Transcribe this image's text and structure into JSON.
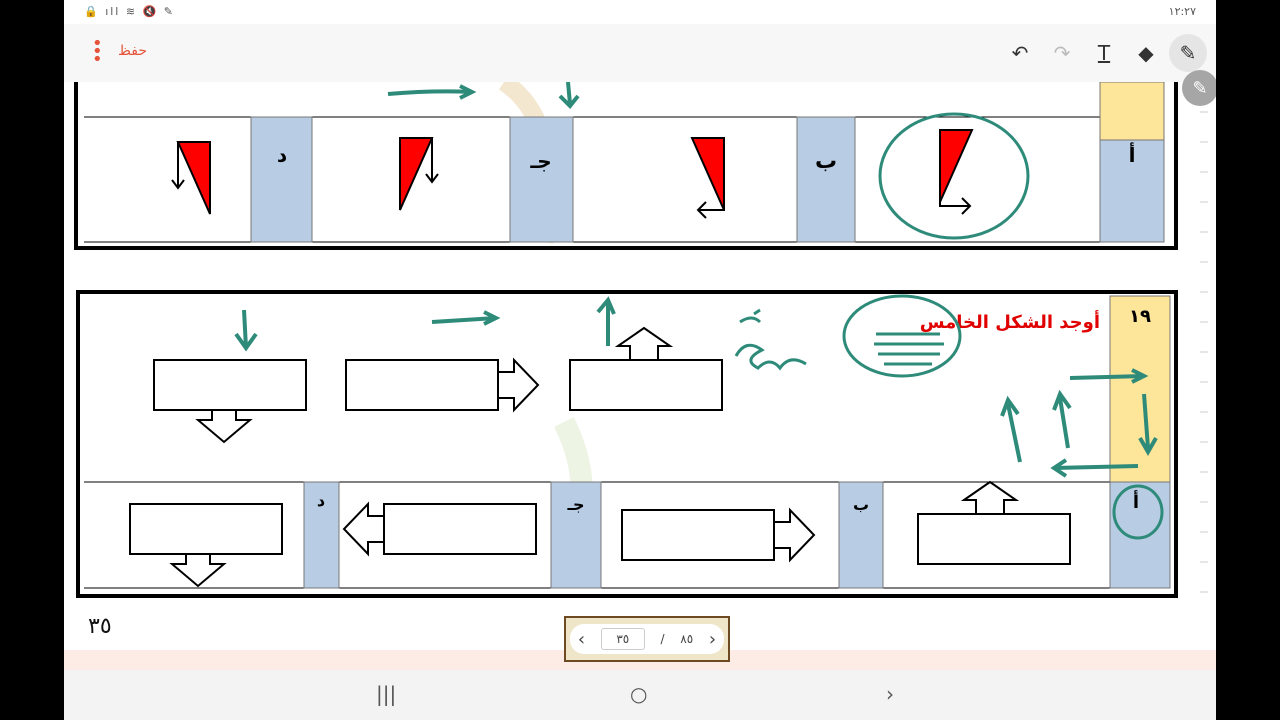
{
  "status_bar": {
    "time": "١٢:٢٧",
    "icons": [
      "lock-icon",
      "signal-icon",
      "wifi-icon",
      "mute-icon",
      "pen-status-icon",
      "dot-icon",
      "screen-record-icon",
      "pinterest-icon",
      "scan-icon"
    ]
  },
  "toolbar": {
    "save_label": "حفظ",
    "undo_icon": "↶",
    "redo_icon": "↷",
    "text_icon": "T",
    "eraser_icon": "◆",
    "pen_icon": "✎",
    "menu_icon": "⋮"
  },
  "worksheet": {
    "top_section": {
      "option_labels": [
        "أ",
        "ب",
        "جـ",
        "د"
      ]
    },
    "bottom_section": {
      "question_number": "١٩",
      "question_text": "أوجد الشكل الخامس",
      "option_labels": [
        "أ",
        "ب",
        "جـ",
        "د"
      ]
    },
    "page_number": "٣٥"
  },
  "pager": {
    "prev_icon": "‹",
    "next_icon": "›",
    "current": "٣٥",
    "separator": "/",
    "total": "٨٥"
  },
  "navigation_bar": {
    "recents_icon": "|||",
    "home_icon": "○",
    "back_icon": "›"
  },
  "colors": {
    "header_yellow": "#fde59a",
    "option_blue": "#b8cce4",
    "arrow_red": "#ff0000",
    "ink_green": "#2e8b7a",
    "save_orange": "#e6533b"
  }
}
